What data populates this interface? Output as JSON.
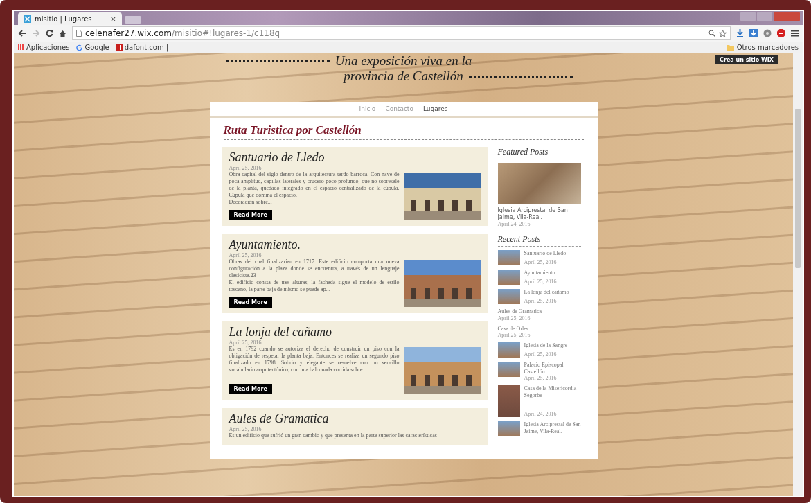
{
  "browser": {
    "tab": {
      "title": "misitio | Lugares",
      "close": "×"
    },
    "address": {
      "host": "celenafer27.wix.com",
      "path": "/misitio#!lugares-1/c118q"
    },
    "bookmarks": [
      {
        "label": "Aplicaciones",
        "kind": "apps"
      },
      {
        "label": "Google",
        "kind": "google"
      },
      {
        "label": "dafont.com |",
        "kind": "dafont"
      }
    ],
    "other_bookmarks": "Otros marcadores"
  },
  "page": {
    "wix_badge": "Crea un sitio WIX",
    "headline": [
      "Una exposición viva en la",
      "provincia de Castellón"
    ],
    "nav": [
      {
        "label": "Inicio",
        "selected": false
      },
      {
        "label": "Contacto",
        "selected": false
      },
      {
        "label": "Lugares",
        "selected": true
      }
    ],
    "blog_title": "Ruta Turistica por Castellón",
    "posts": [
      {
        "title": "Santuario de Lledo",
        "date": "April 25, 2016",
        "excerpt": "Obra capital del siglo dentro de la arquitectura tardo barroca. Con nave de poca amplitud, capillas laterales y crucero poco profundo, que no sobresale de la planta, quedado integrado en el espacio centralizado de la cúpula. Cúpula que domina el espacio.\nDecoración sobre...",
        "button": "Read More"
      },
      {
        "title": "Ayuntamiento.",
        "date": "April 25, 2016",
        "excerpt": "Obras del cual finalizarían en 1717. Este edificio comporta una nueva configuración a la plaza donde se encuentra, a través de un lenguaje clasicista.23\n El edificio consta de tres alturas, la fachada sigue el modelo de estilo toscano, la parte baja de mismo se puede ap...",
        "button": "Read More"
      },
      {
        "title": "La lonja del cañamo",
        "date": "April 25, 2016",
        "excerpt": "Es en 1792 cuando se autoriza el derecho de construir un piso con la obligación de respetar la planta baja. Entonces se realiza un segundo piso finalizado en 1798. Sobrio y elegante se resuelve con un sencillo vocabulario arquitectónico, con una balconada corrida sobre...",
        "button": "Read More"
      },
      {
        "title": "Aules de Gramatica",
        "date": "April 25, 2016",
        "excerpt": "Es un edificio que sufrió un gran cambio y que presenta en la parte superior las características"
      }
    ],
    "featured": {
      "heading": "Featured Posts",
      "title": "Iglesia Arciprestal de San Jaime, Vila-Real.",
      "date": "April 24, 2016"
    },
    "recent": {
      "heading": "Recent Posts",
      "items": [
        {
          "kind": "thumb",
          "title": "Santuario de Lledo",
          "date": "April 25, 2016"
        },
        {
          "kind": "thumb",
          "title": "Ayuntamiento.",
          "date": "April 25, 2016"
        },
        {
          "kind": "thumb",
          "title": "La lonja del cañamo",
          "date": "April 25, 2016"
        },
        {
          "kind": "text",
          "title": "Aules de Gramatica",
          "date": "April 25, 2016"
        },
        {
          "kind": "text",
          "title": "Casa de Orles",
          "date": "April 25, 2016"
        },
        {
          "kind": "thumb",
          "title": "Iglesia de la Sangre",
          "date": "April 25, 2016"
        },
        {
          "kind": "thumb",
          "title": "Palacio Episcopal Castellón",
          "date": "April 25, 2016"
        },
        {
          "kind": "tall",
          "title": "Casa de la Misericordia Segorbe",
          "date": "April 24, 2016"
        },
        {
          "kind": "thumb",
          "title": "Iglesia Arciprestal de San Jaime, Vila-Real."
        }
      ]
    }
  }
}
